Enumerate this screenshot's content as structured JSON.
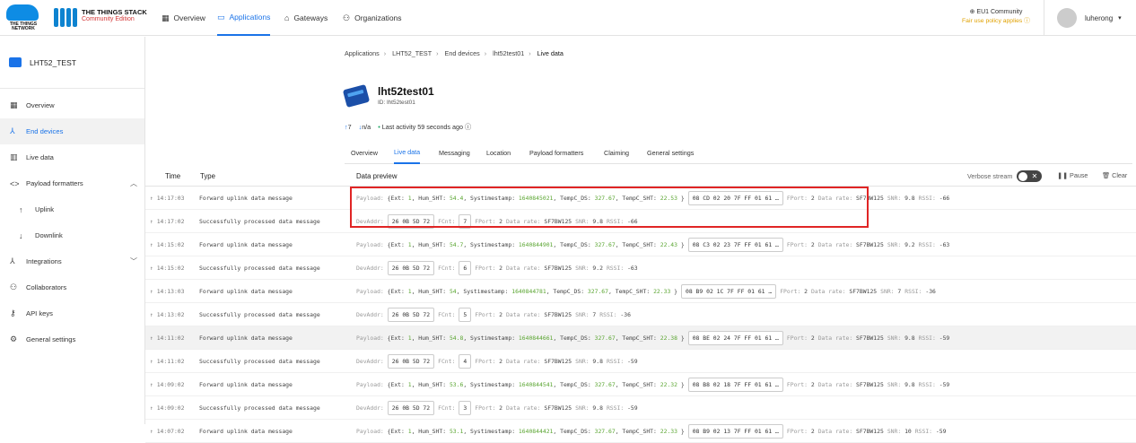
{
  "brand": {
    "ttn_text": "THE THINGS NETWORK",
    "stack_title": "THE THINGS STACK",
    "stack_edition": "Community Edition"
  },
  "topnav": {
    "overview": "Overview",
    "applications": "Applications",
    "gateways": "Gateways",
    "organizations": "Organizations"
  },
  "community": {
    "name": "EU1 Community",
    "fair_use": "Fair use policy applies"
  },
  "user": {
    "name": "luherong"
  },
  "sidebar": {
    "app_name": "LHT52_TEST",
    "items": [
      "Overview",
      "End devices",
      "Live data",
      "Payload formatters",
      "Uplink",
      "Downlink",
      "Integrations",
      "Collaborators",
      "API keys",
      "General settings"
    ]
  },
  "breadcrumb": [
    "Applications",
    "LHT52_TEST",
    "End devices",
    "lht52test01",
    "Live data"
  ],
  "device": {
    "name": "lht52test01",
    "id": "ID: lht52test01",
    "up": "7",
    "down": "n/a",
    "activity": "Last activity 59 seconds ago"
  },
  "tabs": [
    "Overview",
    "Live data",
    "Messaging",
    "Location",
    "Payload formatters",
    "Claiming",
    "General settings"
  ],
  "table": {
    "col_time": "Time",
    "col_type": "Type",
    "col_preview": "Data preview",
    "verbose": "Verbose stream",
    "pause": "Pause",
    "clear": "Clear"
  },
  "rows": [
    {
      "time": "14:17:03",
      "type": "Forward uplink data message",
      "kind": "uplink",
      "ext": "1",
      "hum": "54.4",
      "ts": "1640845021",
      "tds": "327.67",
      "tsht": "22.53",
      "bytes": "08 CD 02 20 7F FF 01 61 …",
      "fport": "2",
      "rate": "SF7BW125",
      "snr": "9.8",
      "rssi": "-66"
    },
    {
      "time": "14:17:02",
      "type": "Successfully processed data message",
      "kind": "processed",
      "addr": "26 0B 5D 72",
      "fcnt": "7",
      "fport": "2",
      "rate": "SF7BW125",
      "snr": "9.8",
      "rssi": "-66"
    },
    {
      "time": "14:15:02",
      "type": "Forward uplink data message",
      "kind": "uplink",
      "ext": "1",
      "hum": "54.7",
      "ts": "1640844901",
      "tds": "327.67",
      "tsht": "22.43",
      "bytes": "08 C3 02 23 7F FF 01 61 …",
      "fport": "2",
      "rate": "SF7BW125",
      "snr": "9.2",
      "rssi": "-63"
    },
    {
      "time": "14:15:02",
      "type": "Successfully processed data message",
      "kind": "processed",
      "addr": "26 0B 5D 72",
      "fcnt": "6",
      "fport": "2",
      "rate": "SF7BW125",
      "snr": "9.2",
      "rssi": "-63"
    },
    {
      "time": "14:13:03",
      "type": "Forward uplink data message",
      "kind": "uplink",
      "ext": "1",
      "hum": "54",
      "ts": "1640844781",
      "tds": "327.67",
      "tsht": "22.33",
      "bytes": "08 B9 02 1C 7F FF 01 61 …",
      "fport": "2",
      "rate": "SF7BW125",
      "snr": "7",
      "rssi": "-36"
    },
    {
      "time": "14:13:02",
      "type": "Successfully processed data message",
      "kind": "processed",
      "addr": "26 0B 5D 72",
      "fcnt": "5",
      "fport": "2",
      "rate": "SF7BW125",
      "snr": "7",
      "rssi": "-36"
    },
    {
      "time": "14:11:02",
      "type": "Forward uplink data message",
      "kind": "uplink",
      "ext": "1",
      "hum": "54.8",
      "ts": "1640844661",
      "tds": "327.67",
      "tsht": "22.38",
      "bytes": "08 BE 02 24 7F FF 01 61 …",
      "fport": "2",
      "rate": "SF7BW125",
      "snr": "9.8",
      "rssi": "-59"
    },
    {
      "time": "14:11:02",
      "type": "Successfully processed data message",
      "kind": "processed",
      "addr": "26 0B 5D 72",
      "fcnt": "4",
      "fport": "2",
      "rate": "SF7BW125",
      "snr": "9.8",
      "rssi": "-59"
    },
    {
      "time": "14:09:02",
      "type": "Forward uplink data message",
      "kind": "uplink",
      "ext": "1",
      "hum": "53.6",
      "ts": "1640844541",
      "tds": "327.67",
      "tsht": "22.32",
      "bytes": "08 B8 02 18 7F FF 01 61 …",
      "fport": "2",
      "rate": "SF7BW125",
      "snr": "9.8",
      "rssi": "-59"
    },
    {
      "time": "14:09:02",
      "type": "Successfully processed data message",
      "kind": "processed",
      "addr": "26 0B 5D 72",
      "fcnt": "3",
      "fport": "2",
      "rate": "SF7BW125",
      "snr": "9.8",
      "rssi": "-59"
    },
    {
      "time": "14:07:02",
      "type": "Forward uplink data message",
      "kind": "uplink",
      "ext": "1",
      "hum": "53.1",
      "ts": "1640844421",
      "tds": "327.67",
      "tsht": "22.33",
      "bytes": "08 B9 02 13 7F FF 01 61 …",
      "fport": "2",
      "rate": "SF7BW125",
      "snr": "10",
      "rssi": "-59"
    }
  ],
  "labels": {
    "payload": "Payload:",
    "ext": "Ext:",
    "hum": "Hum_SHT:",
    "systimestamp": "Systimestamp:",
    "tds": "TempC_DS:",
    "tsht": "TempC_SHT:",
    "fport": "FPort:",
    "rate": "Data rate:",
    "snr": "SNR:",
    "rssi": "RSSI:",
    "devaddr": "DevAddr:",
    "fcnt": "FCnt:"
  },
  "colors": {
    "accent": "#1a73e8",
    "highlight_box": "#e02525",
    "value_green": "#5aa531"
  }
}
